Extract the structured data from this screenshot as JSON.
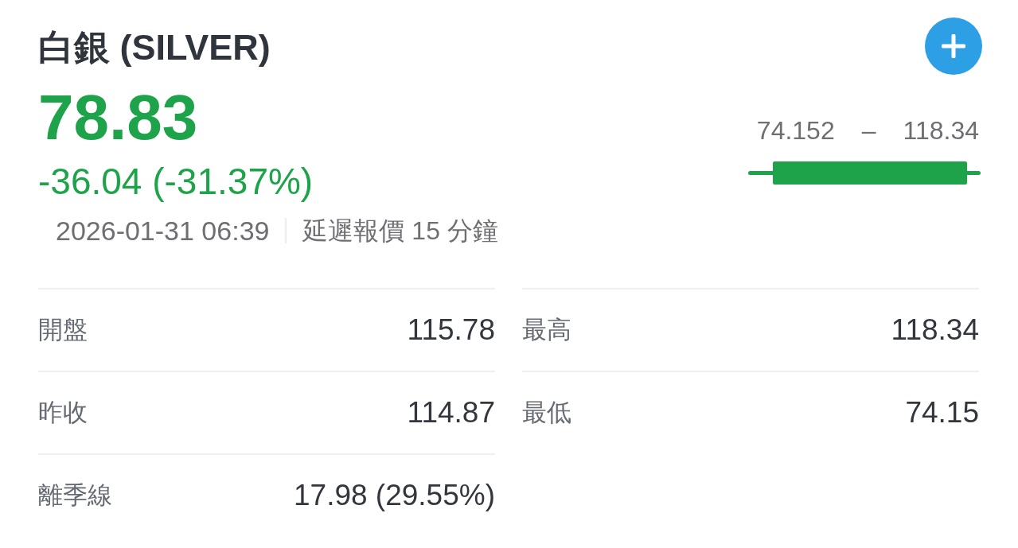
{
  "quote": {
    "title": "白銀 (SILVER)",
    "price": "78.83",
    "change": "-36.04 (-31.37%)",
    "falling": true,
    "timestamp": "2026-01-31 06:39",
    "delay_note": "延遲報價 15 分鐘"
  },
  "day_range": {
    "low": "74.152",
    "separator": "–",
    "high": "118.34"
  },
  "stat_columns": [
    {
      "rows": [
        {
          "label": "開盤",
          "value": "115.78"
        },
        {
          "label": "昨收",
          "value": "114.87"
        },
        {
          "label": "離季線",
          "value": "17.98 (29.55%)"
        }
      ]
    },
    {
      "rows": [
        {
          "label": "最高",
          "value": "118.34"
        },
        {
          "label": "最低",
          "value": "74.15"
        }
      ]
    }
  ]
}
